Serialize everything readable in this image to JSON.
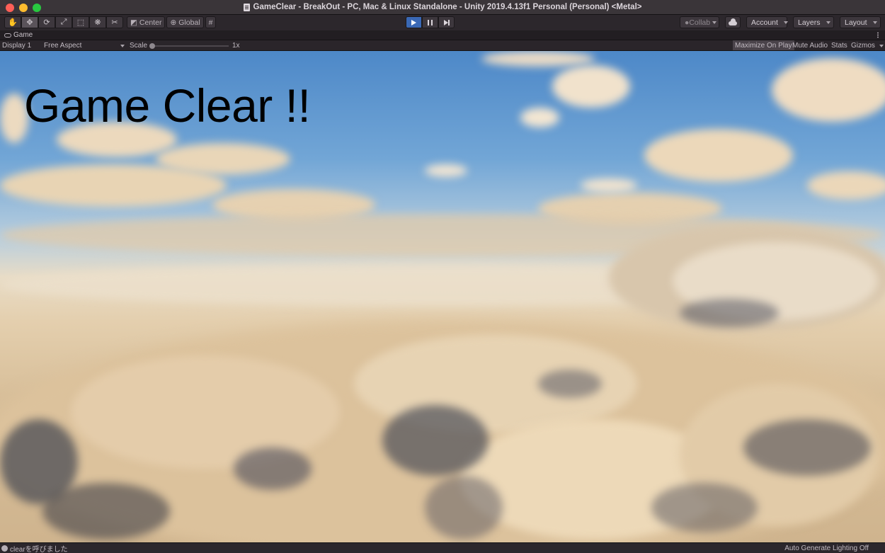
{
  "window": {
    "title": "GameClear - BreakOut - PC, Mac & Linux Standalone - Unity 2019.4.13f1 Personal (Personal) <Metal>"
  },
  "toolbar": {
    "tools": [
      "hand-tool-icon",
      "move-tool-icon",
      "rotate-tool-icon",
      "scale-tool-icon",
      "rect-tool-icon",
      "transform-tool-icon",
      "custom-tool-icon"
    ],
    "pivot_label": "Center",
    "space_label": "Global",
    "collab_label": "Collab",
    "account_label": "Account",
    "layers_label": "Layers",
    "layout_label": "Layout"
  },
  "game_tab": {
    "label": "Game"
  },
  "game_toolbar": {
    "display": "Display 1",
    "aspect": "Free Aspect",
    "scale_label": "Scale",
    "scale_value": "1x",
    "maximize_on_play": "Maximize On Play",
    "mute_audio": "Mute Audio",
    "stats": "Stats",
    "gizmos": "Gizmos"
  },
  "game_view": {
    "overlay_text": "Game Clear !!"
  },
  "status": {
    "message": "clearを呼びました",
    "lighting": "Auto Generate Lighting Off"
  }
}
